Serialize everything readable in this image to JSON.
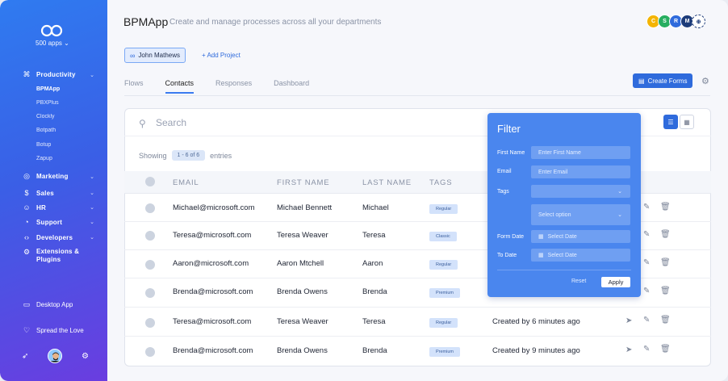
{
  "sidebar": {
    "apps_label": "500 apps",
    "sections": [
      {
        "label": "Productivity",
        "icon": "command-icon"
      },
      {
        "label": "Marketing",
        "icon": "target-icon"
      },
      {
        "label": "Sales",
        "icon": "dollar-icon"
      },
      {
        "label": "HR",
        "icon": "people-icon"
      },
      {
        "label": "Support",
        "icon": "chat-icon"
      },
      {
        "label": "Developers",
        "icon": "code-icon"
      },
      {
        "label": "Extensions & Plugins",
        "icon": "puzzle-icon"
      }
    ],
    "productivity_apps": [
      "BPMApp",
      "PBXPlus",
      "Clockly",
      "Botpath",
      "Botup",
      "Zapup"
    ],
    "desktop_app": "Desktop App",
    "spread_love": "Spread the Love"
  },
  "header": {
    "title": "BPMApp",
    "subtitle": "Create and manage processes across all your departments",
    "avatars": [
      {
        "letter": "C",
        "color": "#f4b400"
      },
      {
        "letter": "S",
        "color": "#27ae60"
      },
      {
        "letter": "R",
        "color": "#2f6bdc"
      },
      {
        "letter": "M",
        "color": "#1d3c7a"
      }
    ]
  },
  "project": {
    "chip_label": "John Mathews",
    "add_label": "+ Add Project"
  },
  "tabs": [
    "Flows",
    "Contacts",
    "Responses",
    "Dashboard"
  ],
  "toolbar": {
    "create_label": "Create Forms"
  },
  "table": {
    "search_placeholder": "Search",
    "showing_prefix": "Showing",
    "showing_range": "1 - 6 of 6",
    "showing_suffix": "entries",
    "columns": [
      "EMAIL",
      "FIRST NAME",
      "LAST NAME",
      "TAGS"
    ],
    "rows": [
      {
        "email": "Michael@microsoft.com",
        "first": "Michael Bennett",
        "last": "Michael",
        "tag": "Regular",
        "created": ""
      },
      {
        "email": "Teresa@microsoft.com",
        "first": "Teresa Weaver",
        "last": "Teresa",
        "tag": "Classic",
        "created": ""
      },
      {
        "email": "Aaron@microsoft.com",
        "first": "Aaron Mtchell",
        "last": "Aaron",
        "tag": "Regular",
        "created": ""
      },
      {
        "email": "Brenda@microsoft.com",
        "first": "Brenda Owens",
        "last": "Brenda",
        "tag": "Premium",
        "created": ""
      },
      {
        "email": "Teresa@microsoft.com",
        "first": "Teresa Weaver",
        "last": "Teresa",
        "tag": "Regular",
        "created": "Created by 6 minutes ago"
      },
      {
        "email": "Brenda@microsoft.com",
        "first": "Brenda Owens",
        "last": "Brenda",
        "tag": "Premium",
        "created": "Created by 9 minutes ago"
      }
    ]
  },
  "filter": {
    "title": "Filter",
    "first_name_label": "First Name",
    "first_name_placeholder": "Enter First Name",
    "email_label": "Email",
    "email_placeholder": "Enter Email",
    "tags_label": "Tags",
    "select_placeholder": "Select  option",
    "form_date_label": "Form Date",
    "to_date_label": "To Date",
    "date_placeholder": "Select Date",
    "reset_label": "Reset",
    "apply_label": "Apply"
  }
}
